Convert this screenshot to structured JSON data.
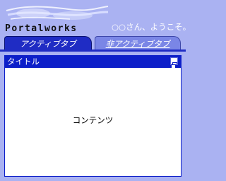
{
  "header": {
    "logo_name": "Portalworks",
    "welcome_text": "○○さん、ようこそ。"
  },
  "tabs": [
    {
      "label": "アクティブタブ",
      "state": "active"
    },
    {
      "label": "非アクティブタブ",
      "state": "inactive"
    }
  ],
  "portlet": {
    "title": "タイトル",
    "content": "コンテンツ",
    "title_button_icon": "window-restore-icon"
  },
  "colors": {
    "background": "#aab2f2",
    "tab_active": "#1f2cc4",
    "tab_inactive": "#7a86e6",
    "portlet_title_bar": "#0d1fc9",
    "portlet_body": "#ffffff"
  }
}
